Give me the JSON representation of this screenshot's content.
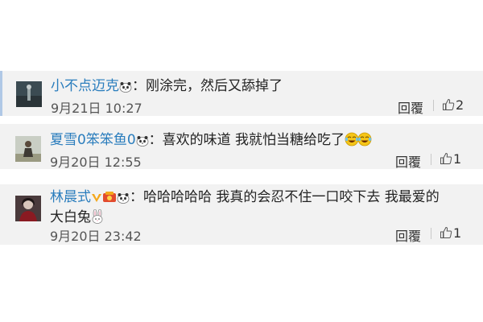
{
  "comments": [
    {
      "username": "小不点迈克",
      "separator": "：",
      "text": "刚涂完，然后又舔掉了",
      "time": "9月21日 10:27",
      "reply_label": "回覆",
      "likes": "2"
    },
    {
      "username": "夏雪0笨笨鱼0",
      "separator": "：",
      "text": "喜欢的味道 我就怕当糖给吃了",
      "time": "9月20日 12:55",
      "reply_label": "回覆",
      "likes": "1"
    },
    {
      "username": "林晨式",
      "separator": "：",
      "text_line1": "哈哈哈哈哈 我真的会忍不住一口咬下去 我最爱的",
      "text_line2": "大白兔",
      "time": "9月20日 23:42",
      "reply_label": "回覆",
      "likes": "1"
    }
  ],
  "colors": {
    "username": "#2a7dbd",
    "card_background": "#f2f2f2",
    "active_border": "#b0c8e6"
  },
  "icons": [
    "panda-emoji-icon",
    "laugh-cry-emoji-icon",
    "verified-v-icon",
    "rabbit-emoji-icon",
    "thumb-up-icon"
  ]
}
